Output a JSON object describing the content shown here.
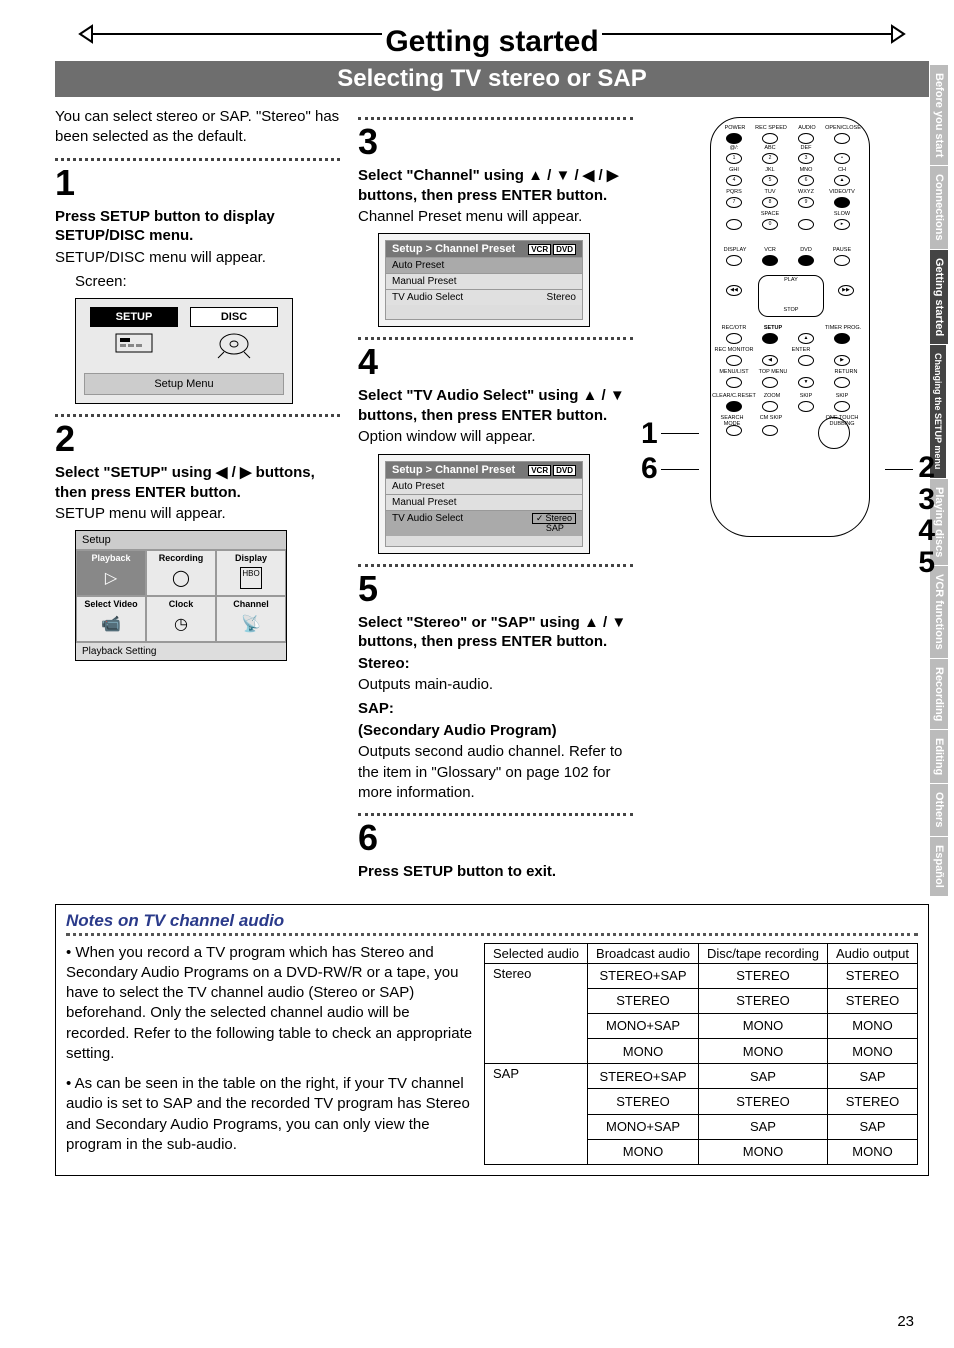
{
  "header": {
    "chapter": "Getting started",
    "section": "Selecting TV stereo or SAP"
  },
  "intro": "You can select stereo or SAP. \"Stereo\" has been selected as the default.",
  "steps": {
    "s1": {
      "num": "1",
      "head": "Press SETUP button to display SETUP/DISC menu.",
      "body": "SETUP/DISC menu will appear.",
      "screenLabel": "Screen:",
      "tile_setup": "SETUP",
      "tile_disc": "DISC",
      "caption": "Setup Menu"
    },
    "s2": {
      "num": "2",
      "head": "Select \"SETUP\" using ◀ / ▶ buttons, then press ENTER button.",
      "body": "SETUP menu will appear.",
      "grid_title": "Setup",
      "cells": [
        "Playback",
        "Recording",
        "Display",
        "Select Video",
        "Clock",
        "Channel"
      ],
      "grid_foot": "Playback Setting"
    },
    "s3": {
      "num": "3",
      "head": "Select \"Channel\" using ▲ / ▼ / ◀ / ▶ buttons, then press ENTER button.",
      "body": "Channel Preset menu will appear.",
      "sb_path": "Setup > Channel Preset",
      "tagsVCR": "VCR",
      "tagsDVD": "DVD",
      "row1": "Auto Preset",
      "row2": "Manual Preset",
      "row3": "TV Audio Select",
      "row3v": "Stereo"
    },
    "s4": {
      "num": "4",
      "head": "Select \"TV Audio Select\" using ▲ / ▼ buttons, then press ENTER button.",
      "body": "Option window will appear.",
      "opt_stereo": "Stereo",
      "opt_sap": "SAP"
    },
    "s5": {
      "num": "5",
      "head": "Select \"Stereo\" or \"SAP\" using ▲ / ▼ buttons, then press ENTER button.",
      "stereo_lbl": "Stereo:",
      "stereo_txt": "Outputs main-audio.",
      "sap_lbl": "SAP:",
      "sap_sub": "(Secondary Audio Program)",
      "sap_txt": "Outputs second audio channel. Refer to the item in \"Glossary\" on page 102 for more information."
    },
    "s6": {
      "num": "6",
      "head": "Press SETUP button to exit."
    }
  },
  "remote": {
    "topRow": [
      "POWER",
      "REC SPEED",
      "AUDIO",
      "OPEN/CLOSE"
    ],
    "numpad": [
      [
        "@/:",
        "ABC",
        "DEF",
        ""
      ],
      [
        "GHI",
        "JKL",
        "MNO",
        "CH"
      ],
      [
        "PQRS",
        "TUV",
        "WXYZ",
        "VIDEO/TV"
      ],
      [
        "",
        "SPACE",
        "",
        "SLOW"
      ]
    ],
    "nums": [
      [
        "1",
        "2",
        "3",
        "•"
      ],
      [
        "4",
        "5",
        "6",
        "▲"
      ],
      [
        "7",
        "8",
        "9",
        "●"
      ],
      [
        "",
        "0",
        "",
        "▸"
      ]
    ],
    "row5": [
      "DISPLAY",
      "VCR",
      "DVD",
      "PAUSE"
    ],
    "play": "PLAY",
    "stop": "STOP",
    "row6": [
      "REC/OTR",
      "SETUP",
      "",
      "TIMER PROG."
    ],
    "row7": [
      "REC MONITOR",
      "",
      "ENTER",
      ""
    ],
    "row8": [
      "MENU/LIST",
      "TOP MENU",
      "",
      "RETURN"
    ],
    "row9": [
      "CLEAR/C.RESET",
      "ZOOM",
      "SKIP",
      "SKIP"
    ],
    "row10": [
      "SEARCH MODE",
      "CM SKIP",
      "",
      "ONE TOUCH DUBBING"
    ]
  },
  "callouts": {
    "left1": "1",
    "left6": "6",
    "right": "2\n3\n4\n5"
  },
  "notes": {
    "title": "Notes on TV channel audio",
    "p1": "• When you record a TV program which has Stereo and Secondary Audio Programs on a DVD-RW/R or a tape, you have to select the TV channel audio (Stereo or SAP) beforehand. Only the selected channel audio will be recorded. Refer to the following table to check an appropriate setting.",
    "p2": "• As can be seen in the table on the right, if your TV channel audio is set to SAP and the recorded TV program has Stereo and Secondary Audio Programs, you can only view the program in the sub-audio."
  },
  "chart_data": {
    "type": "table",
    "columns": [
      "Selected audio",
      "Broadcast audio",
      "Disc/tape recording",
      "Audio output"
    ],
    "rows": [
      [
        "Stereo",
        "STEREO+SAP",
        "STEREO",
        "STEREO"
      ],
      [
        "Stereo",
        "STEREO",
        "STEREO",
        "STEREO"
      ],
      [
        "Stereo",
        "MONO+SAP",
        "MONO",
        "MONO"
      ],
      [
        "Stereo",
        "MONO",
        "MONO",
        "MONO"
      ],
      [
        "SAP",
        "STEREO+SAP",
        "SAP",
        "SAP"
      ],
      [
        "SAP",
        "STEREO",
        "STEREO",
        "STEREO"
      ],
      [
        "SAP",
        "MONO+SAP",
        "SAP",
        "SAP"
      ],
      [
        "SAP",
        "MONO",
        "MONO",
        "MONO"
      ]
    ]
  },
  "tabs": [
    "Before you start",
    "Connections",
    "Getting started",
    "Changing the SETUP menu",
    "Playing discs",
    "VCR functions",
    "Recording",
    "Editing",
    "Others",
    "Español"
  ],
  "pagenum": "23"
}
